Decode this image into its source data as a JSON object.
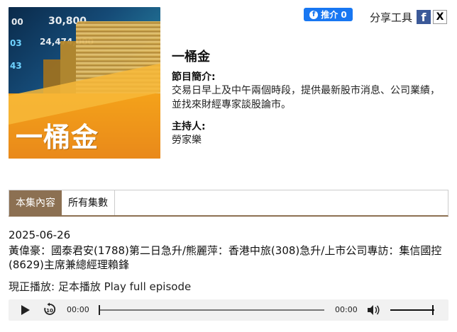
{
  "cover": {
    "title": "一桶金",
    "ticker_numbers": [
      "00",
      "30,800",
      "24,474,000",
      "03",
      "43"
    ]
  },
  "share": {
    "like_label": "推介 0",
    "tools_label": "分享工具"
  },
  "program": {
    "title": "一桶金",
    "intro_label": "節目簡介:",
    "intro_text": "交易日早上及中午兩個時段，提供最新股市消息、公司業績，並找來財經專家談股論市。",
    "host_label": "主持人:",
    "host_name": "勞家樂"
  },
  "tabs": [
    {
      "label": "本集內容",
      "active": true
    },
    {
      "label": "所有集數",
      "active": false
    }
  ],
  "episode": {
    "date": "2025-06-26",
    "title": "黃偉豪：國泰君安(1788)第二日急升/熊麗萍：香港中旅(308)急升/上市公司專訪：集信國控(8629)主席兼總經理賴鋒",
    "now_playing": "現正播放: 足本播放 Play full episode"
  },
  "player": {
    "current_time": "00:00",
    "duration": "00:00",
    "progress": 0,
    "volume": 1.0
  },
  "colors": {
    "tab_active": "#8c7052",
    "facebook": "#1877f2",
    "cover_orange": "#f39b1b"
  }
}
